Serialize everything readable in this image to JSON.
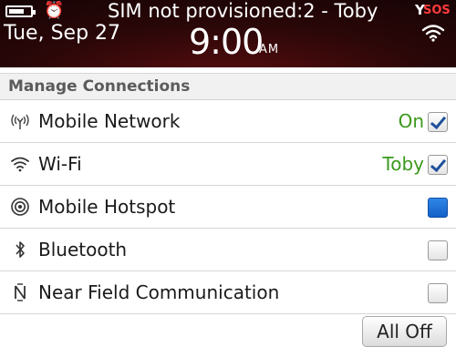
{
  "status": {
    "carrier": "SIM not provisioned:2 - Toby",
    "date": "Tue, Sep 27",
    "time": "9:00",
    "ampm": "AM",
    "sos": "SOS",
    "icons": [
      "battery-icon",
      "alarm-clock-icon",
      "signal-icon",
      "wifi-icon"
    ]
  },
  "manage": {
    "title": "Manage Connections",
    "rows": [
      {
        "label": "Mobile Network",
        "status": "On",
        "checked": true,
        "icon": "antenna-icon"
      },
      {
        "label": "Wi-Fi",
        "status": "Toby",
        "checked": true,
        "icon": "wifi-icon"
      },
      {
        "label": "Mobile Hotspot",
        "status": "",
        "checked": false,
        "active": true,
        "icon": "hotspot-icon"
      },
      {
        "label": "Bluetooth",
        "status": "",
        "checked": false,
        "icon": "bluetooth-icon"
      },
      {
        "label": "Near Field Communication",
        "status": "",
        "checked": false,
        "icon": "nfc-icon"
      }
    ],
    "all_off_label": "All Off"
  },
  "colors": {
    "status_on": "#3b9a1d",
    "header_bg": "#2a0708",
    "checkbox_active": "#1e6fd8",
    "sos": "#ff3b3b"
  }
}
